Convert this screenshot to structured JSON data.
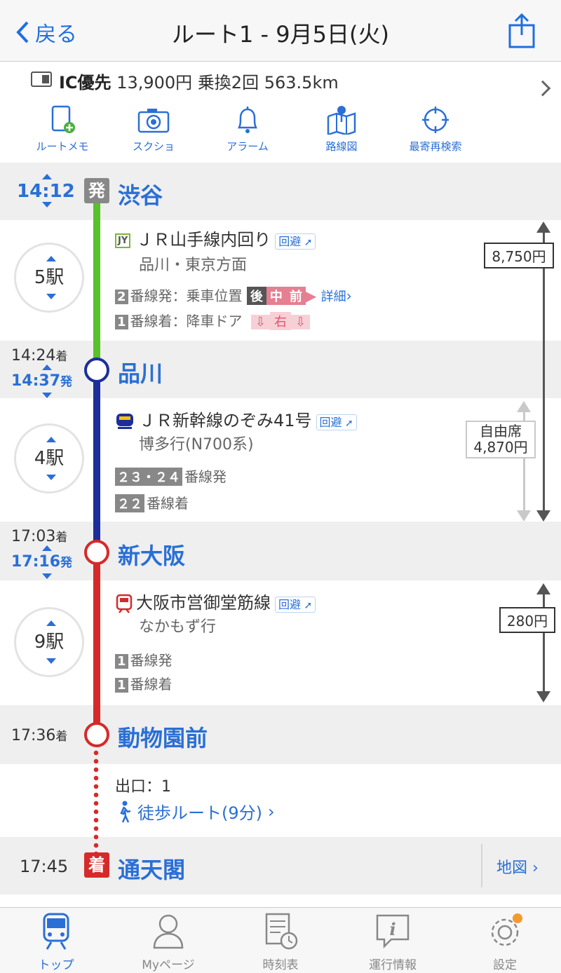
{
  "nav": {
    "back_label": "戻る",
    "title": "ルート1 - 9月5日(火)"
  },
  "summary": {
    "mode": "IC優先",
    "fare": "13,900円",
    "transfers": "乗換2回",
    "distance": "563.5km"
  },
  "tools": [
    {
      "label": "ルートメモ",
      "icon": "memo-icon"
    },
    {
      "label": "スクショ",
      "icon": "camera-icon"
    },
    {
      "label": "アラーム",
      "icon": "bell-icon"
    },
    {
      "label": "路線図",
      "icon": "map-pin-icon"
    },
    {
      "label": "最寄再検索",
      "icon": "crosshair-icon"
    }
  ],
  "origin": {
    "time": "14:12",
    "badge": "発",
    "name": "渋谷"
  },
  "seg1": {
    "count": "5駅",
    "line": "ＪＲ山手線内回り",
    "badge": "JY",
    "avoid": "回避",
    "direction": "品川・東京方面",
    "dep_plat": "2",
    "dep_text": "番線発：乗車位置",
    "pos": [
      "後",
      "中",
      "前"
    ],
    "detail": "詳細",
    "arr_plat": "1",
    "arr_text": "番線着：降車ドア",
    "door": "右",
    "color": "#58c12b"
  },
  "st1": {
    "arr": "14:24",
    "arr_suffix": "着",
    "dep": "14:37",
    "dep_suffix": "発",
    "name": "品川"
  },
  "seg2": {
    "count": "4駅",
    "line": "ＪＲ新幹線のぞみ41号",
    "avoid": "回避",
    "direction": "博多行(N700系)",
    "dep_plat": "２３・２４",
    "dep_text": "番線発",
    "arr_plat": "２２",
    "arr_text": "番線着",
    "color": "#1d2e9a"
  },
  "st2": {
    "arr": "17:03",
    "arr_suffix": "着",
    "dep": "17:16",
    "dep_suffix": "発",
    "name": "新大阪"
  },
  "seg3": {
    "count": "9駅",
    "line": "大阪市営御堂筋線",
    "avoid": "回避",
    "direction": "なかもず行",
    "dep_plat": "1",
    "dep_text": "番線発",
    "arr_plat": "1",
    "arr_text": "番線着",
    "color": "#d62a2a"
  },
  "st3": {
    "arr": "17:36",
    "arr_suffix": "着",
    "name": "動物園前"
  },
  "walk": {
    "exit": "出口：1",
    "route": "徒歩ルート(9分)"
  },
  "dest": {
    "time": "17:45",
    "badge": "着",
    "name": "通天閣",
    "map": "地図"
  },
  "fares": {
    "fare1": "8,750円",
    "fare2_label": "自由席",
    "fare2": "4,870円",
    "fare3": "280円"
  },
  "tabs": [
    {
      "label": "トップ",
      "icon": "train-icon",
      "active": true
    },
    {
      "label": "Myページ",
      "icon": "person-icon"
    },
    {
      "label": "時刻表",
      "icon": "timetable-icon"
    },
    {
      "label": "運行情報",
      "icon": "info-icon"
    },
    {
      "label": "設定",
      "icon": "gear-icon"
    }
  ]
}
